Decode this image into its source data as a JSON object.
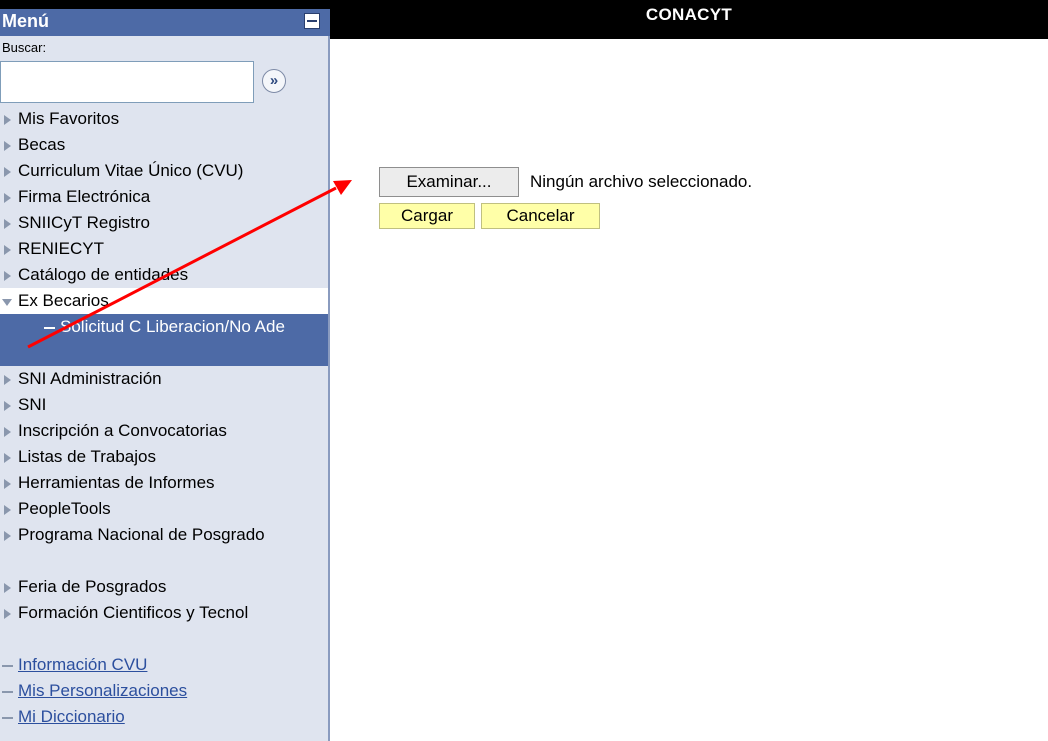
{
  "header": {
    "title": "CONACYT"
  },
  "menu": {
    "title": "Menú",
    "search_label": "Buscar:",
    "search_value": "",
    "go_symbol": "»",
    "items": [
      {
        "label": "Mis Favoritos"
      },
      {
        "label": "Becas"
      },
      {
        "label": "Curriculum Vitae Único (CVU)"
      },
      {
        "label": "Firma Electrónica"
      },
      {
        "label": "SNIICyT Registro"
      },
      {
        "label": "RENIECYT"
      },
      {
        "label": "Catálogo de entidades"
      },
      {
        "label": "Ex Becarios"
      },
      {
        "label": "Solicitud C Liberacion/No Ade"
      },
      {
        "label": "SNI Administración"
      },
      {
        "label": "SNI"
      },
      {
        "label": "Inscripción a Convocatorias"
      },
      {
        "label": "Listas de Trabajos"
      },
      {
        "label": "Herramientas de Informes"
      },
      {
        "label": "PeopleTools"
      },
      {
        "label": "Programa Nacional de Posgrado"
      },
      {
        "label": "Feria de Posgrados"
      },
      {
        "label": "Formación Cientificos y Tecnol"
      },
      {
        "label": "Información CVU"
      },
      {
        "label": "Mis Personalizaciones"
      },
      {
        "label": "Mi Diccionario"
      }
    ]
  },
  "upload": {
    "browse_label": "Examinar...",
    "file_status": "Ningún archivo seleccionado.",
    "load_label": "Cargar",
    "cancel_label": "Cancelar"
  },
  "colors": {
    "menu_header": "#4d6aa6",
    "menu_bg": "#dfe4ef",
    "button_yellow": "#ffffa8",
    "annotation_arrow": "#ff0000"
  }
}
